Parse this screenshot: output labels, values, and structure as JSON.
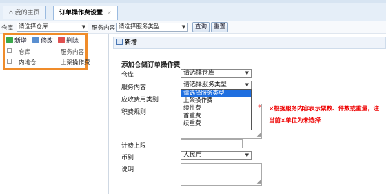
{
  "tabs": [
    {
      "label": "我的主页",
      "icon": "home-icon"
    },
    {
      "label": "订单操作费设置",
      "close": "×"
    }
  ],
  "filter": {
    "warehouse_label": "仓库",
    "warehouse_value": "请选择仓库",
    "service_label": "服务内容",
    "service_value": "请选择服务类型",
    "query_label": "查询",
    "reset_label": "重置"
  },
  "toolbar": {
    "add": "新增",
    "edit": "修改",
    "delete": "删除"
  },
  "list": {
    "headers": [
      "仓库",
      "服务内容"
    ],
    "rows": [
      [
        "内地仓",
        "上架操作费"
      ]
    ]
  },
  "panel": {
    "title": "新增"
  },
  "form": {
    "title": "添加仓储订单操作费",
    "warehouse_label": "仓库",
    "warehouse_value": "请选择仓库",
    "service_label": "服务内容",
    "service_value": "请选择服务类型",
    "receivable_label": "应收费用类别",
    "rule_label": "积费规则",
    "limit_label": "计费上限",
    "currency_label": "币别",
    "currency_value": "人民币",
    "note_label": "说明",
    "required_mark": "*",
    "hint_line1": "×根据服务内容表示票数、件数或重量，注",
    "hint_line2": "当前×单位为未选择"
  },
  "dropdown": {
    "options": [
      "请选择服务类型",
      "上架操作费",
      "续件费",
      "首重费",
      "续重费"
    ],
    "selected_index": 0
  },
  "colors": {
    "highlight": "#f08c2a",
    "selected": "#1f6fe0",
    "warning": "#e00000"
  }
}
